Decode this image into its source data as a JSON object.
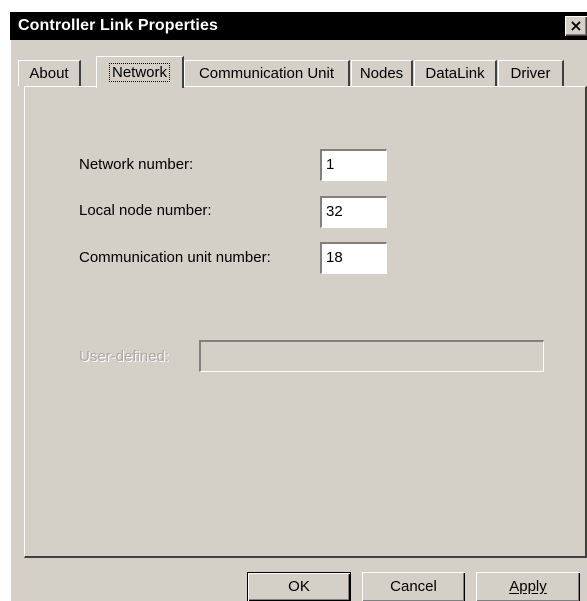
{
  "window": {
    "title": "Controller Link Properties",
    "close_glyph": "×"
  },
  "tabs": [
    {
      "label": "About"
    },
    {
      "label": "Network"
    },
    {
      "label": "Communication Unit"
    },
    {
      "label": "Nodes"
    },
    {
      "label": "DataLink"
    },
    {
      "label": "Driver"
    }
  ],
  "active_tab": "Network",
  "fields": {
    "network_number": {
      "label": "Network number:",
      "value": "1"
    },
    "local_node_number": {
      "label": "Local node number:",
      "value": "32"
    },
    "communication_unit_number": {
      "label": "Communication unit number:",
      "value": "18"
    },
    "user_defined": {
      "label": "User-defined:",
      "value": "",
      "enabled": false
    }
  },
  "buttons": {
    "ok": "OK",
    "cancel": "Cancel",
    "apply": "Apply"
  },
  "colors": {
    "dialog_face": "#d4d0c8",
    "title_bar": "#000000",
    "title_text": "#ffffff",
    "disabled_text": "#a8a8a8"
  },
  "icons": {
    "close": "close-icon"
  }
}
